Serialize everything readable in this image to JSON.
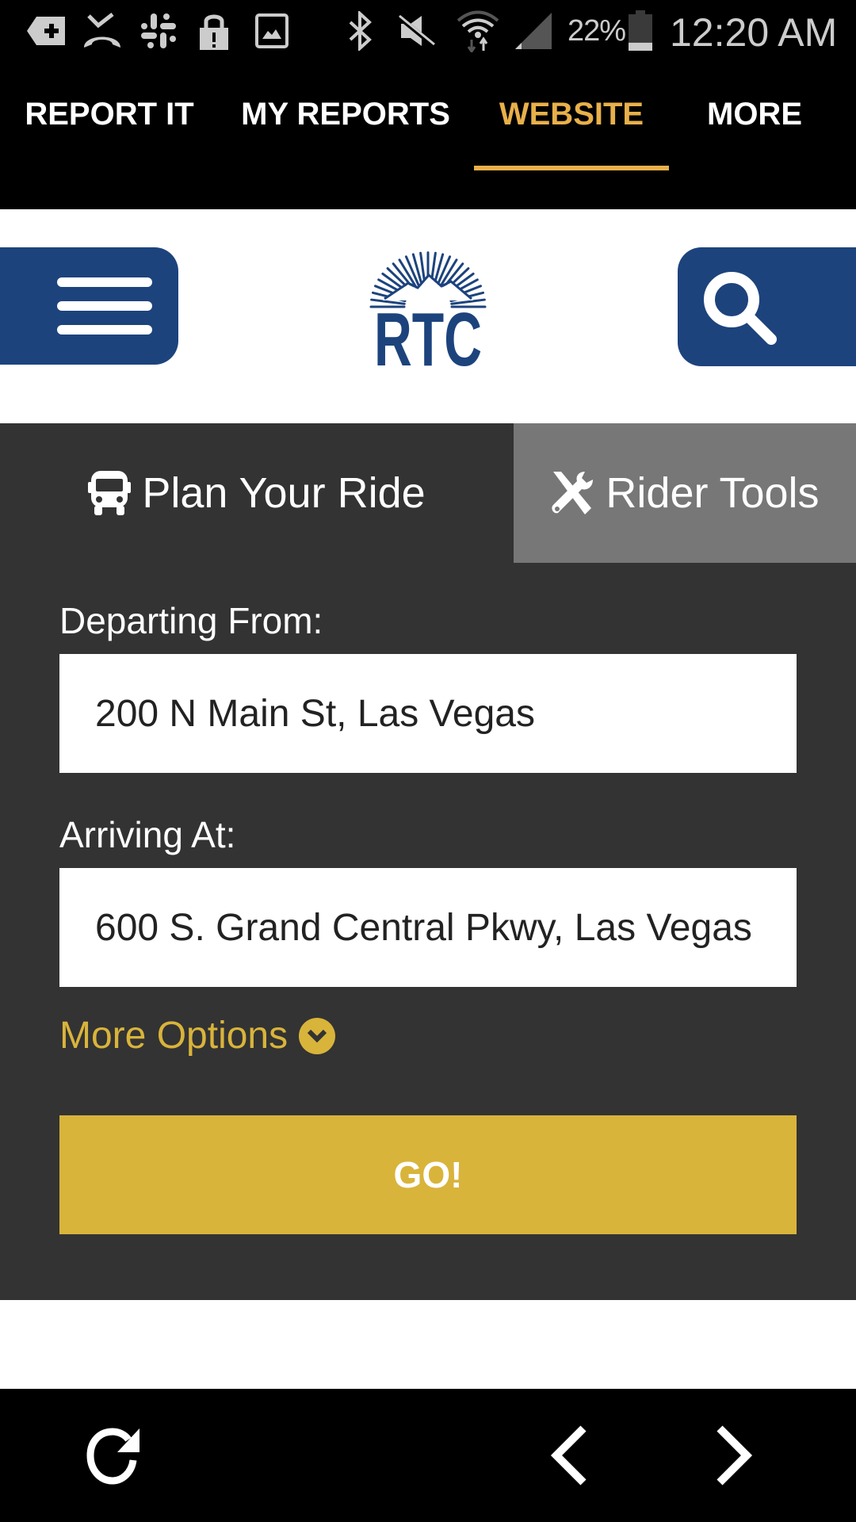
{
  "status_bar": {
    "left_icons": [
      "add-contact-icon",
      "missed-call-icon",
      "slack-icon",
      "lock-alert-icon",
      "image-icon"
    ],
    "right_icons": [
      "bluetooth-icon",
      "mute-icon",
      "wifi-icon",
      "signal-icon",
      "battery-icon"
    ],
    "battery_percent": "22%",
    "battery_level": 0.22,
    "time": "12:20 AM"
  },
  "app_tabs": {
    "items": [
      {
        "label": "REPORT IT",
        "active": false
      },
      {
        "label": "MY REPORTS",
        "active": false
      },
      {
        "label": "WEBSITE",
        "active": true
      },
      {
        "label": "MORE",
        "active": false
      }
    ]
  },
  "header": {
    "logo_text": "RTC",
    "menu_icon": "hamburger-menu-icon",
    "search_icon": "search-icon"
  },
  "planner": {
    "tabs": [
      {
        "label": "Plan Your Ride",
        "icon": "bus-icon",
        "active": true
      },
      {
        "label": "Rider Tools",
        "icon": "tools-icon",
        "active": false
      }
    ],
    "departing_label": "Departing From:",
    "departing_value": "200 N Main St, Las Vegas",
    "arriving_label": "Arriving At:",
    "arriving_value": "600 S. Grand Central Pkwy, Las Vegas",
    "more_options_label": "More Options",
    "go_label": "GO!"
  },
  "browser_toolbar": {
    "refresh_icon": "refresh-icon",
    "back_icon": "chevron-left-icon",
    "forward_icon": "chevron-right-icon"
  },
  "colors": {
    "brand_blue": "#1d437d",
    "accent_gold": "#d9b43b",
    "tab_gold": "#e8b04a",
    "panel_dark": "#333333",
    "tab_inactive_gray": "#777777"
  }
}
